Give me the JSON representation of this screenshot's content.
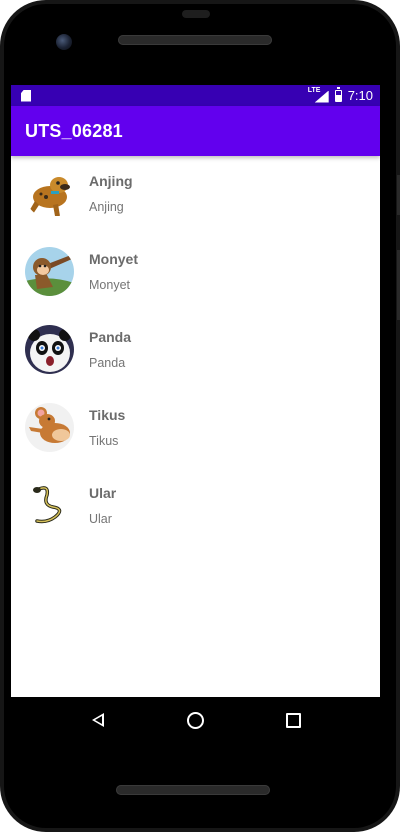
{
  "status_bar": {
    "time": "7:10",
    "network": "LTE",
    "icons": [
      "sd-card-icon",
      "lte-signal-icon",
      "battery-icon"
    ]
  },
  "app_bar": {
    "title": "UTS_06281"
  },
  "animals": [
    {
      "name": "Anjing",
      "subtitle": "Anjing",
      "avatar": "dog-avatar"
    },
    {
      "name": "Monyet",
      "subtitle": "Monyet",
      "avatar": "monkey-avatar"
    },
    {
      "name": "Panda",
      "subtitle": "Panda",
      "avatar": "panda-avatar"
    },
    {
      "name": "Tikus",
      "subtitle": "Tikus",
      "avatar": "mouse-avatar"
    },
    {
      "name": "Ular",
      "subtitle": "Ular",
      "avatar": "snake-avatar"
    }
  ],
  "nav_bar": {
    "icons": [
      "back-icon",
      "home-icon",
      "recents-icon"
    ]
  },
  "colors": {
    "status_bar": "#3700b3",
    "app_bar": "#6200ee",
    "title_text": "#6b6b6b",
    "subtitle_text": "#757575"
  }
}
